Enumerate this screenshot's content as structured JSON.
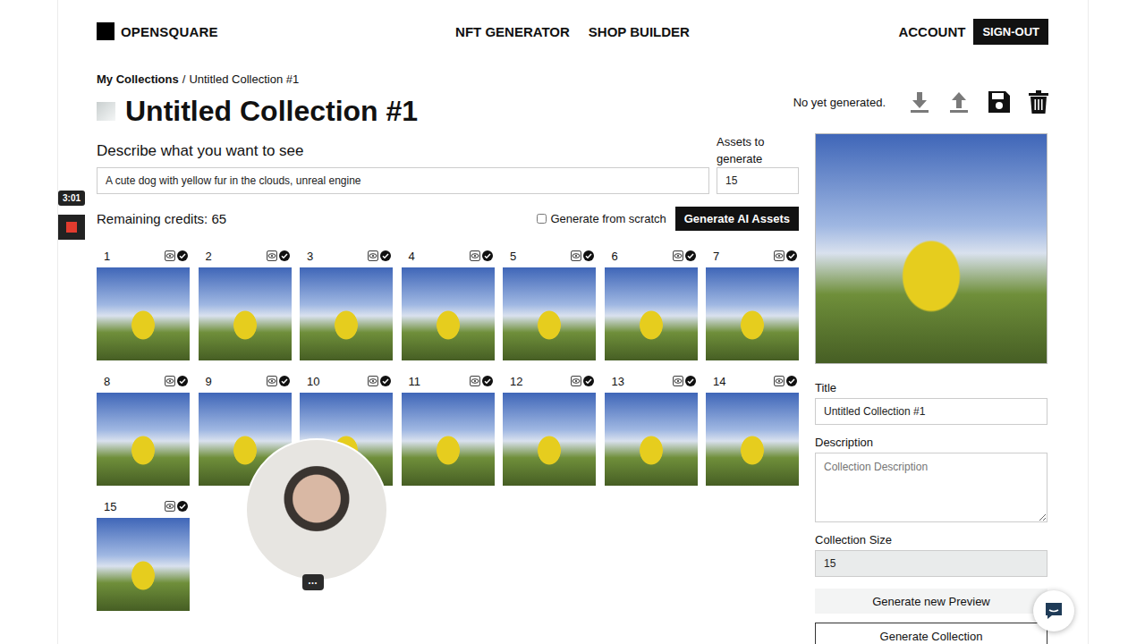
{
  "recorder": {
    "time": "3:01"
  },
  "header": {
    "logo": "OPENSQUARE",
    "nav": [
      {
        "label": "NFT GENERATOR"
      },
      {
        "label": "SHOP BUILDER"
      }
    ],
    "account": "ACCOUNT",
    "sign_out": "SIGN-OUT"
  },
  "breadcrumb": {
    "parent": "My Collections",
    "separator": "/",
    "current": "Untitled Collection #1"
  },
  "title": "Untitled Collection #1",
  "status": "No yet generated.",
  "prompt": {
    "label": "Describe what you want to see",
    "value": "A cute dog with yellow fur in the clouds, unreal engine"
  },
  "assets": {
    "label": "Assets to generate",
    "value": "15"
  },
  "credits": "Remaining credits: 65",
  "from_scratch": {
    "label": "Generate from scratch",
    "checked": false
  },
  "generate_button": "Generate AI Assets",
  "grid": [
    {
      "number": "1",
      "checked": true
    },
    {
      "number": "2",
      "checked": true
    },
    {
      "number": "3",
      "checked": true
    },
    {
      "number": "4",
      "checked": true
    },
    {
      "number": "5",
      "checked": true
    },
    {
      "number": "6",
      "checked": true
    },
    {
      "number": "7",
      "checked": true
    },
    {
      "number": "8",
      "checked": true
    },
    {
      "number": "9",
      "checked": true
    },
    {
      "number": "10",
      "checked": true
    },
    {
      "number": "11",
      "checked": true
    },
    {
      "number": "12",
      "checked": true
    },
    {
      "number": "13",
      "checked": true
    },
    {
      "number": "14",
      "checked": true
    },
    {
      "number": "15",
      "checked": true
    }
  ],
  "panel": {
    "title_label": "Title",
    "title_value": "Untitled Collection #1",
    "description_label": "Description",
    "description_placeholder": "Collection Description",
    "size_label": "Collection Size",
    "size_value": "15",
    "preview_button": "Generate new Preview",
    "collection_button": "Generate Collection"
  },
  "webcam": {
    "menu": "•••"
  }
}
